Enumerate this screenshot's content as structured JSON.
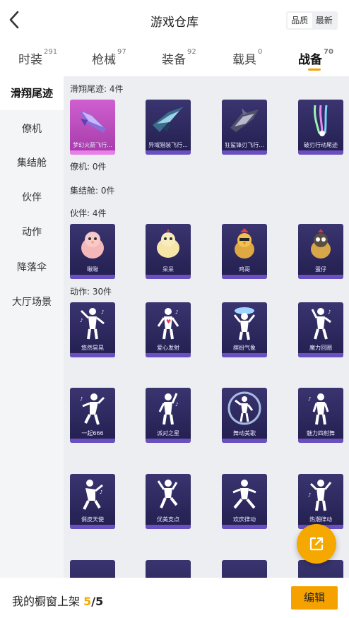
{
  "header": {
    "title": "游戏仓库",
    "sort_options": [
      "品质",
      "最新"
    ]
  },
  "tabs": [
    {
      "label": "时装",
      "count": "291"
    },
    {
      "label": "枪械",
      "count": "97"
    },
    {
      "label": "装备",
      "count": "92"
    },
    {
      "label": "载具",
      "count": "0"
    },
    {
      "label": "战备",
      "count": "70"
    }
  ],
  "sidebar": {
    "items": [
      {
        "label": "滑翔尾迹"
      },
      {
        "label": "僚机"
      },
      {
        "label": "集结舱"
      },
      {
        "label": "伙伴"
      },
      {
        "label": "动作"
      },
      {
        "label": "降落伞"
      },
      {
        "label": "大厅场景"
      }
    ]
  },
  "sections": {
    "trail": {
      "title": "滑翔尾迹: 4件",
      "items": [
        {
          "label": "梦幻火箭飞行..."
        },
        {
          "label": "异域猎装飞行..."
        },
        {
          "label": "狂鲨锋刃飞行..."
        },
        {
          "label": "破刃行动尾迹"
        }
      ]
    },
    "wingman": {
      "title": "僚机: 0件"
    },
    "capsule": {
      "title": "集结舱: 0件"
    },
    "partner": {
      "title": "伙伴: 4件",
      "items": [
        {
          "label": "啾啾"
        },
        {
          "label": "呆呆"
        },
        {
          "label": "鸡哥"
        },
        {
          "label": "蛋仔"
        }
      ]
    },
    "emote": {
      "title": "动作: 30件",
      "items": [
        {
          "label": "悠然晃晃"
        },
        {
          "label": "爱心发射"
        },
        {
          "label": "缤纷气象"
        },
        {
          "label": "魔力回圈"
        },
        {
          "label": "一起666"
        },
        {
          "label": "派对之星"
        },
        {
          "label": "舞动美歌"
        },
        {
          "label": "魅力四射舞"
        },
        {
          "label": "俏皮天使"
        },
        {
          "label": "优美支点"
        },
        {
          "label": "欢庆律动"
        },
        {
          "label": "热潮律动"
        },
        {
          "label": ""
        },
        {
          "label": ""
        },
        {
          "label": ""
        },
        {
          "label": ""
        }
      ]
    }
  },
  "bottom": {
    "label": "我的橱窗上架",
    "current": "5",
    "total": "/5",
    "edit_label": "编辑"
  },
  "colors": {
    "accent": "#f5a200",
    "card_purple": "#2e2a60",
    "card_pink": "#c04cc4"
  }
}
